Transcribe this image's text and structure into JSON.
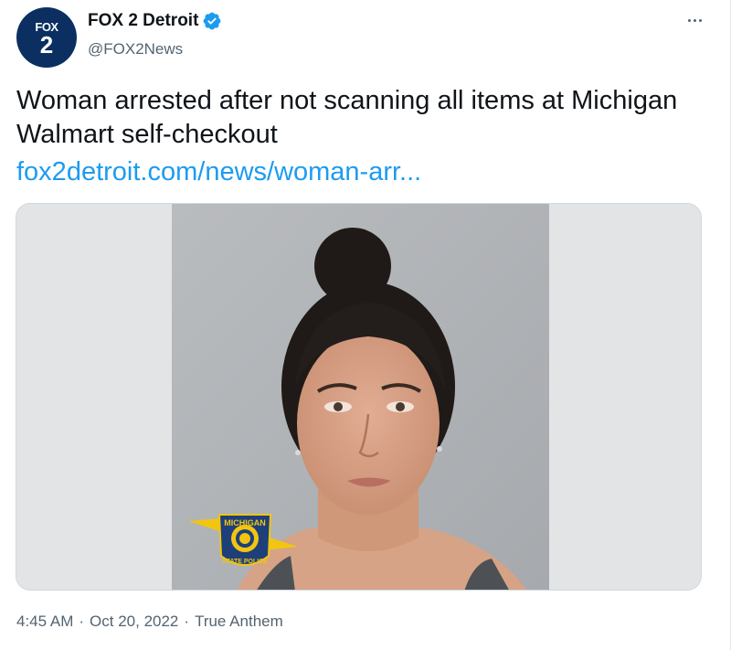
{
  "account": {
    "avatar_top": "FOX",
    "avatar_bottom": "2",
    "display_name": "FOX 2 Detroit",
    "handle": "@FOX2News"
  },
  "tweet": {
    "text": "Woman arrested after not scanning all items at Michigan Walmart self-checkout",
    "link": "fox2detroit.com/news/woman-arr..."
  },
  "media": {
    "badge_top": "MICHIGAN",
    "badge_bottom": "STATE POLICE"
  },
  "meta": {
    "time": "4:45 AM",
    "separator1": "·",
    "date": "Oct 20, 2022",
    "separator2": "·",
    "source": "True Anthem"
  },
  "colors": {
    "link": "#1d9bf0",
    "verified": "#1d9bf0",
    "muted": "#536471",
    "avatar_bg": "#0b2f60"
  },
  "icons": {
    "verified": "verified-badge-icon",
    "more": "more-options-icon"
  }
}
